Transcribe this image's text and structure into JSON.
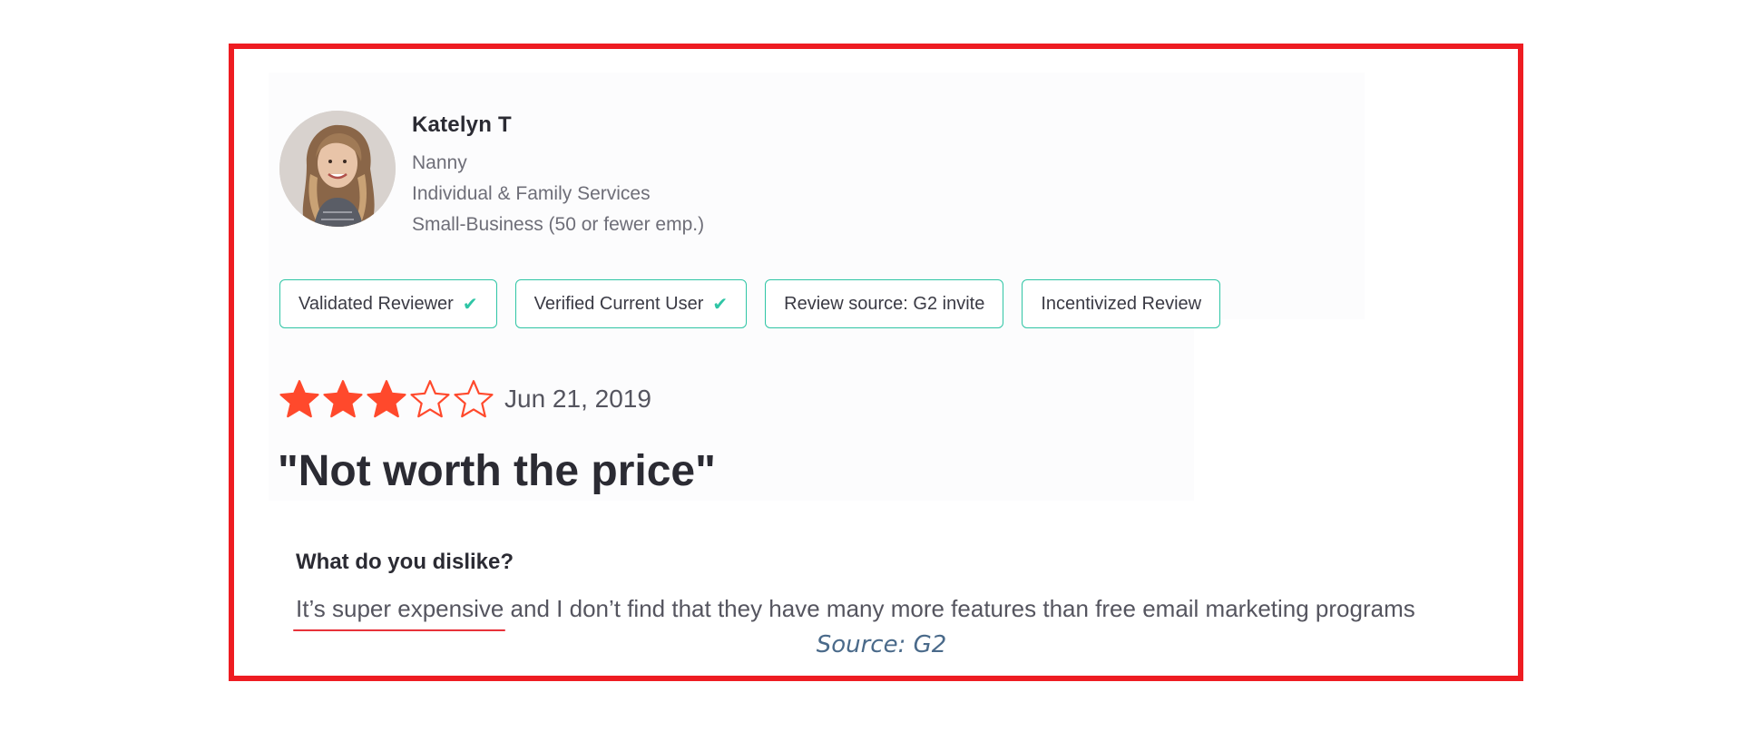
{
  "reviewer": {
    "name": "Katelyn T",
    "role": "Nanny",
    "industry": "Individual & Family Services",
    "company_size": "Small-Business (50 or fewer emp.)",
    "avatar_icon": "person-photo"
  },
  "badges": [
    {
      "label": "Validated Reviewer",
      "check": "✔"
    },
    {
      "label": "Verified Current User",
      "check": "✔"
    },
    {
      "label": "Review source: G2 invite"
    },
    {
      "label": "Incentivized Review"
    }
  ],
  "rating": {
    "value": 3,
    "max": 5,
    "star_color": "#ff492c"
  },
  "date": "Jun 21, 2019",
  "title": "\"Not worth the price\"",
  "section": {
    "question": "What do you dislike?",
    "answer_highlight": "It’s super expensive",
    "answer_rest": " and I don’t find that they have many more features than free email marketing programs"
  },
  "source": "Source: G2",
  "colors": {
    "frame": "#ee1c22",
    "badge_border": "#2fc5a5",
    "underline": "#e8323a"
  }
}
